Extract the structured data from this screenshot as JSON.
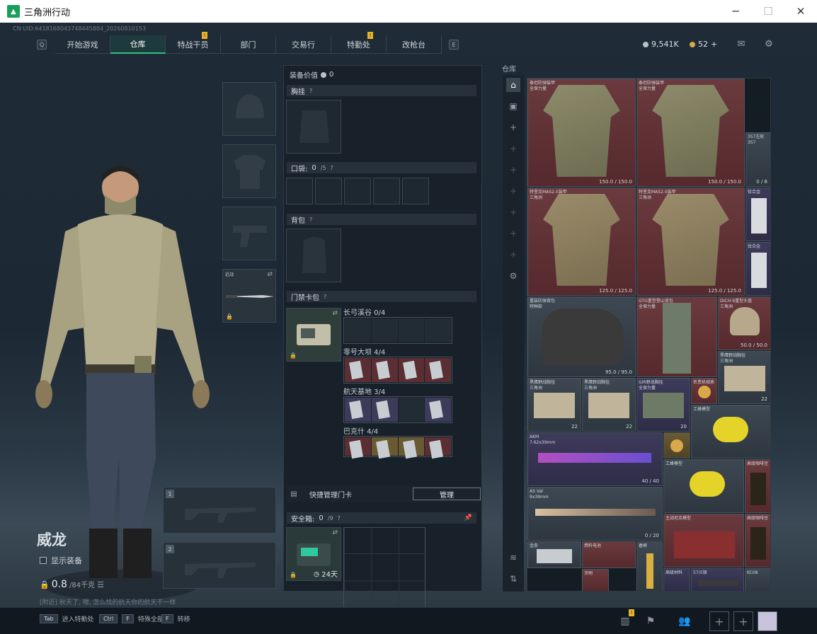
{
  "window": {
    "title": "三角洲行动",
    "logo_glyph": "▲"
  },
  "nav": {
    "uid": "CN:UID:6418168043748445884_20260810153",
    "key_left": "Q",
    "key_right": "E",
    "tabs": [
      {
        "label": "开始游戏"
      },
      {
        "label": "仓库"
      },
      {
        "label": "特战干员"
      },
      {
        "label": "部门"
      },
      {
        "label": "交易行"
      },
      {
        "label": "特勤处"
      },
      {
        "label": "改枪台"
      }
    ],
    "badge": "!",
    "active_tab": "仓库",
    "currency_silver": "9,541K",
    "currency_gold": "52",
    "currency_add": "+"
  },
  "character": {
    "name": "威龙",
    "show_equipment": "显示装备",
    "weight_value": "0.8",
    "weight_max": "/84千克",
    "chat_line": "[附近] 秋天了, 喂, 怎么找的航天你的航天不一样"
  },
  "left_slots": {
    "knife_label": "近战",
    "weapon1_num": "1",
    "weapon2_num": "2"
  },
  "equip": {
    "value_label": "装备价值",
    "value": "0",
    "chest_rig": "胸挂",
    "pockets": "口袋:",
    "pockets_count": "0",
    "pockets_max": "/5",
    "backpack": "背包",
    "keycard_pack": "门禁卡包",
    "help": "?",
    "maps": [
      {
        "name": "长弓溪谷 0/4",
        "filled": 0
      },
      {
        "name": "零号大坝 4/4",
        "filled": 4
      },
      {
        "name": "航天基地 3/4",
        "filled": 3
      },
      {
        "name": "巴克什 4/4",
        "filled": 4
      }
    ],
    "quick_manage": "快捷管理门卡",
    "manage_button": "管理",
    "safe_box": "安全箱:",
    "safe_count": "0",
    "safe_max": "/9",
    "safe_days": "24天"
  },
  "warehouse": {
    "title": "仓库",
    "items": {
      "armor_a_name": "泰坦防弹装甲\n全保力量",
      "armor_a_dur": "150.0 / 150.0",
      "armor_b_name": "泰坦防弹装甲\n全保力量",
      "armor_b_dur": "150.0 / 150.0",
      "revolver_name": "357左轮\n357",
      "revolver_cnt": "0 / 6",
      "armor_c_name": "特里克MAS2.0装甲\n三角洲",
      "armor_c_dur": "125.0 / 125.0",
      "armor_d_name": "特里克MAS2.0装甲\n三角洲",
      "armor_d_dur": "125.0 / 125.0",
      "plate_a_name": "钛合金",
      "plate_b_name": "钛合金",
      "pack_a_name": "重装防弹背包\n特种款",
      "pack_a_dur": "95.0 / 95.0",
      "bag_gto_name": "GTO重型登山背包\n全保力量",
      "helmet_name": "DICH-9重型头盔\n三角洲",
      "helmet_dur": "50.0 / 50.0",
      "rig_a_name": "黑鹰野战胸挂\n三角洲",
      "rig_a_cnt": "22",
      "rig_b_name": "黑鹰野战胸挂\n三角洲",
      "rig_b_cnt": "22",
      "rig_c_name": "黑鹰野战胸挂\n三角洲",
      "rig_c_cnt": "22",
      "rig_d_name": "GIR野战胸挂\n全保力量",
      "rig_d_cnt": "20",
      "watch_name": "名贵机械表",
      "bee_a_name": "工蜂模型",
      "ak_name": "AKM\n7.62x39mm",
      "ak_cnt": "40 / 40",
      "as_name": "AS Val\n9x39mm",
      "as_cnt": "0 / 20",
      "bee_b_name": "工蜂模型",
      "coffee_a_name": "高级咖啡豆",
      "tank_name": "主战坦克模型",
      "coffee_b_name": "高级咖啡豆",
      "bar_name": "金条",
      "fan_name": "燃料电池",
      "bottle_name": "香槟",
      "tooth_name": "牙刷",
      "misc_name": "高级材料",
      "scope_name": "57/5镜",
      "k_name": "KC08"
    }
  },
  "bottombar": {
    "hint1_key": "Tab",
    "hint1_text": "进入特勤处",
    "hint2_key": "Ctrl",
    "hint2_key2": "F",
    "hint2_text": "特殊全部",
    "hint3_key": "F",
    "hint3_text": "转移",
    "badge": "!"
  },
  "colors": {
    "accent": "#29c285",
    "badge": "#e7b428",
    "red_item": "#6a3a3e",
    "purple_item": "#3d3b5a"
  }
}
